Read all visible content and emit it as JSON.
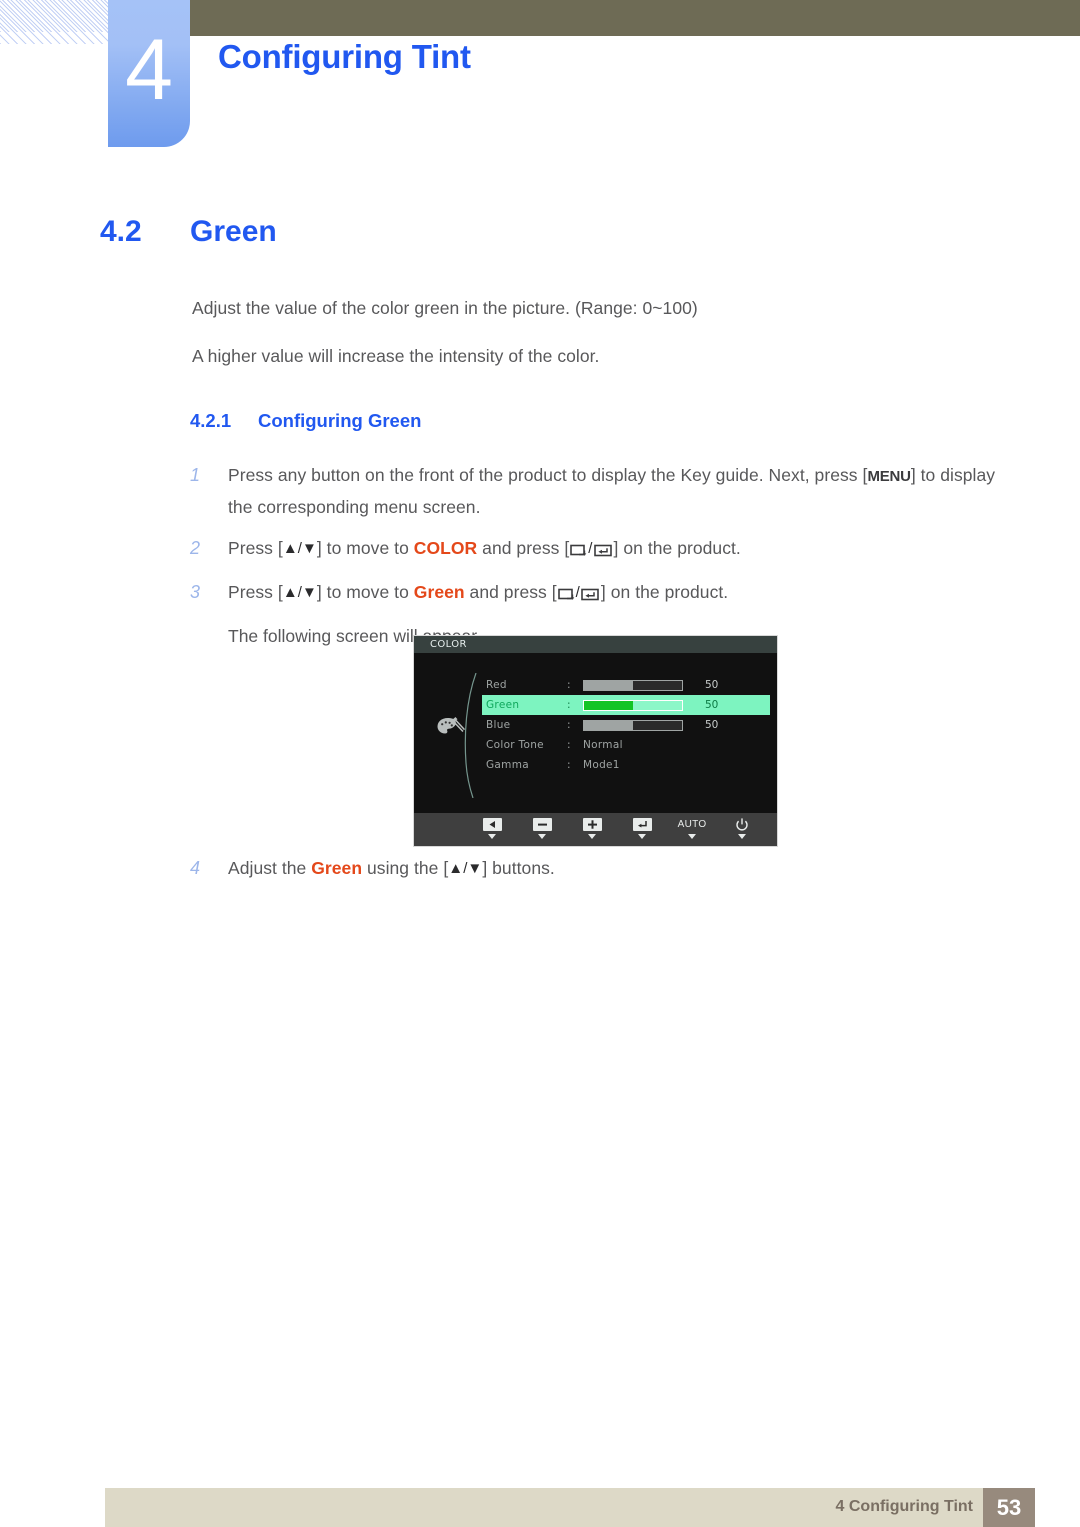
{
  "header": {
    "chapter_number": "4",
    "chapter_title": "Configuring Tint"
  },
  "section": {
    "number": "4.2",
    "title": "Green"
  },
  "intro": {
    "line1": "Adjust the value of the color green in the picture. (Range: 0~100)",
    "line2": "A higher value will increase the intensity of the color."
  },
  "subsection": {
    "number": "4.2.1",
    "title": "Configuring Green"
  },
  "steps": [
    {
      "num": "1",
      "text_a": "Press any button on the front of the product to display the Key guide. Next, press [",
      "key": "MENU",
      "text_b": "] to display",
      "line2": "the corresponding menu screen."
    },
    {
      "num": "2",
      "text_a": "Press [",
      "text_b": "] to move to ",
      "keyword": "COLOR",
      "text_c": " and press [",
      "text_d": "] on the product."
    },
    {
      "num": "3",
      "text_a": "Press [",
      "text_b": "] to move to ",
      "keyword": "Green",
      "text_c": " and press [",
      "text_d": "] on the product.",
      "note": "The following screen will appear."
    },
    {
      "num": "4",
      "text_a": "Adjust the ",
      "keyword": "Green",
      "text_b": " using the [",
      "text_c": "] buttons."
    }
  ],
  "osd": {
    "title": "COLOR",
    "rows": [
      {
        "label": "Red",
        "colon": ":",
        "type": "slider",
        "value": "50",
        "fill_pct": 50,
        "selected": false
      },
      {
        "label": "Green",
        "colon": ":",
        "type": "slider",
        "value": "50",
        "fill_pct": 50,
        "selected": true
      },
      {
        "label": "Blue",
        "colon": ":",
        "type": "slider",
        "value": "50",
        "fill_pct": 50,
        "selected": false
      },
      {
        "label": "Color Tone",
        "colon": ":",
        "type": "text",
        "value": "Normal",
        "selected": false
      },
      {
        "label": "Gamma",
        "colon": ":",
        "type": "text",
        "value": "Mode1",
        "selected": false
      }
    ],
    "buttons": [
      {
        "icon": "left-triangle-icon",
        "label": ""
      },
      {
        "icon": "minus-icon",
        "label": ""
      },
      {
        "icon": "plus-icon",
        "label": ""
      },
      {
        "icon": "enter-icon",
        "label": ""
      },
      {
        "icon": "auto-text",
        "label": "AUTO"
      },
      {
        "icon": "power-icon",
        "label": ""
      }
    ]
  },
  "footer": {
    "text": "4 Configuring Tint",
    "page": "53"
  },
  "colors": {
    "heading_blue": "#2158f0",
    "keyword_orange": "#e4481a",
    "olive_bar": "#6e6b55",
    "tab_blue": "#a5c2f7",
    "footer_bar": "#ddd9c7",
    "page_box": "#978a7d",
    "osd_green": "#13c425",
    "osd_highlight": "#7df4c0"
  }
}
